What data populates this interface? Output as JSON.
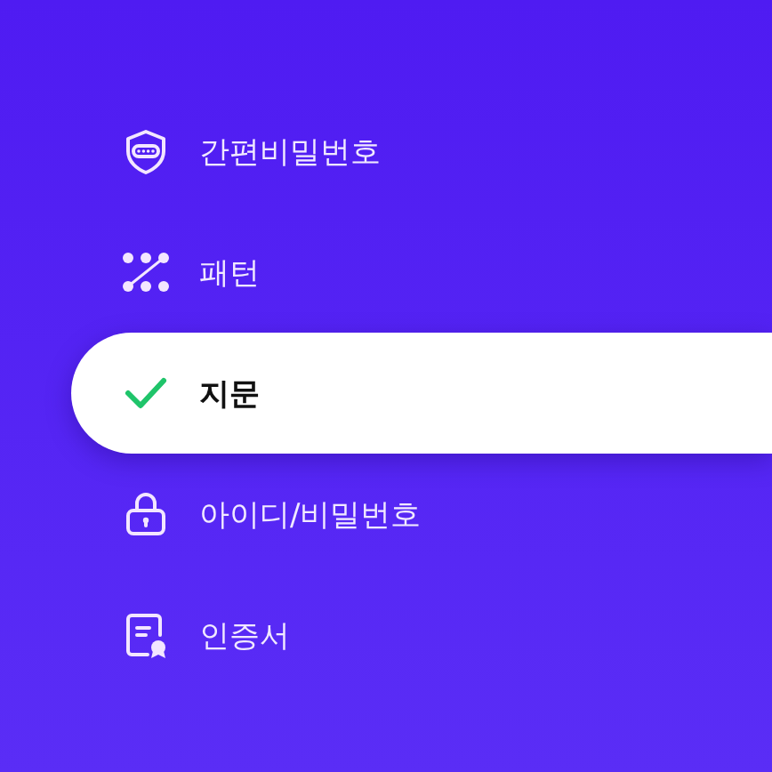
{
  "menu": [
    {
      "label": "간편비밀번호",
      "kind": "shield",
      "selected": false
    },
    {
      "label": "패턴",
      "kind": "pattern",
      "selected": false
    },
    {
      "label": "지문",
      "kind": "check",
      "selected": true
    },
    {
      "label": "아이디/비밀번호",
      "kind": "lock",
      "selected": false
    },
    {
      "label": "인증서",
      "kind": "certificate",
      "selected": false
    }
  ]
}
